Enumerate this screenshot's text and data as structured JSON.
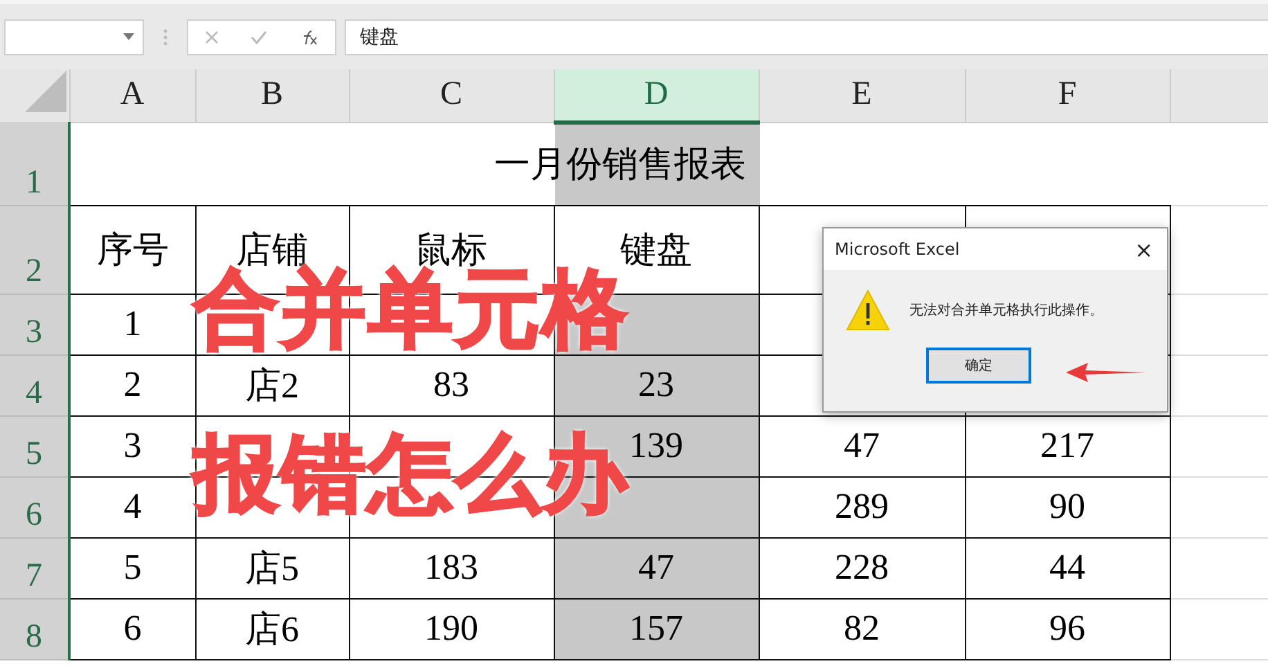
{
  "formula_bar": {
    "content": "键盘"
  },
  "columns": [
    {
      "label": "A",
      "selected": false
    },
    {
      "label": "B",
      "selected": false
    },
    {
      "label": "C",
      "selected": false
    },
    {
      "label": "D",
      "selected": true
    },
    {
      "label": "E",
      "selected": false
    },
    {
      "label": "F",
      "selected": false
    },
    {
      "selected": false
    }
  ],
  "rows": [
    {
      "number": "1",
      "kind": "title",
      "title": "一月份销售报表"
    },
    {
      "number": "2",
      "kind": "header",
      "cells": [
        "序号",
        "店铺",
        "鼠标",
        "键盘",
        null,
        null
      ]
    },
    {
      "number": "3",
      "kind": "data",
      "cells": [
        "1",
        null,
        null,
        null,
        null,
        null
      ]
    },
    {
      "number": "4",
      "kind": "data",
      "cells": [
        "2",
        "店2",
        "83",
        "23",
        null,
        null
      ]
    },
    {
      "number": "5",
      "kind": "data",
      "cells": [
        "3",
        null,
        null,
        "139",
        "47",
        "217"
      ]
    },
    {
      "number": "6",
      "kind": "data",
      "cells": [
        "4",
        null,
        null,
        null,
        "289",
        "90"
      ]
    },
    {
      "number": "7",
      "kind": "data",
      "cells": [
        "5",
        "店5",
        "183",
        "47",
        "228",
        "44"
      ]
    },
    {
      "number": "8",
      "kind": "data",
      "cells": [
        "6",
        "店6",
        "190",
        "157",
        "82",
        "96"
      ]
    }
  ],
  "overlay_text": [
    "合并单元格",
    "报错怎么办"
  ],
  "dialog": {
    "title": "Microsoft Excel",
    "close": "×",
    "message": "无法对合并单元格执行此操作。",
    "button": {
      "label": "确定",
      "focused": true
    }
  }
}
